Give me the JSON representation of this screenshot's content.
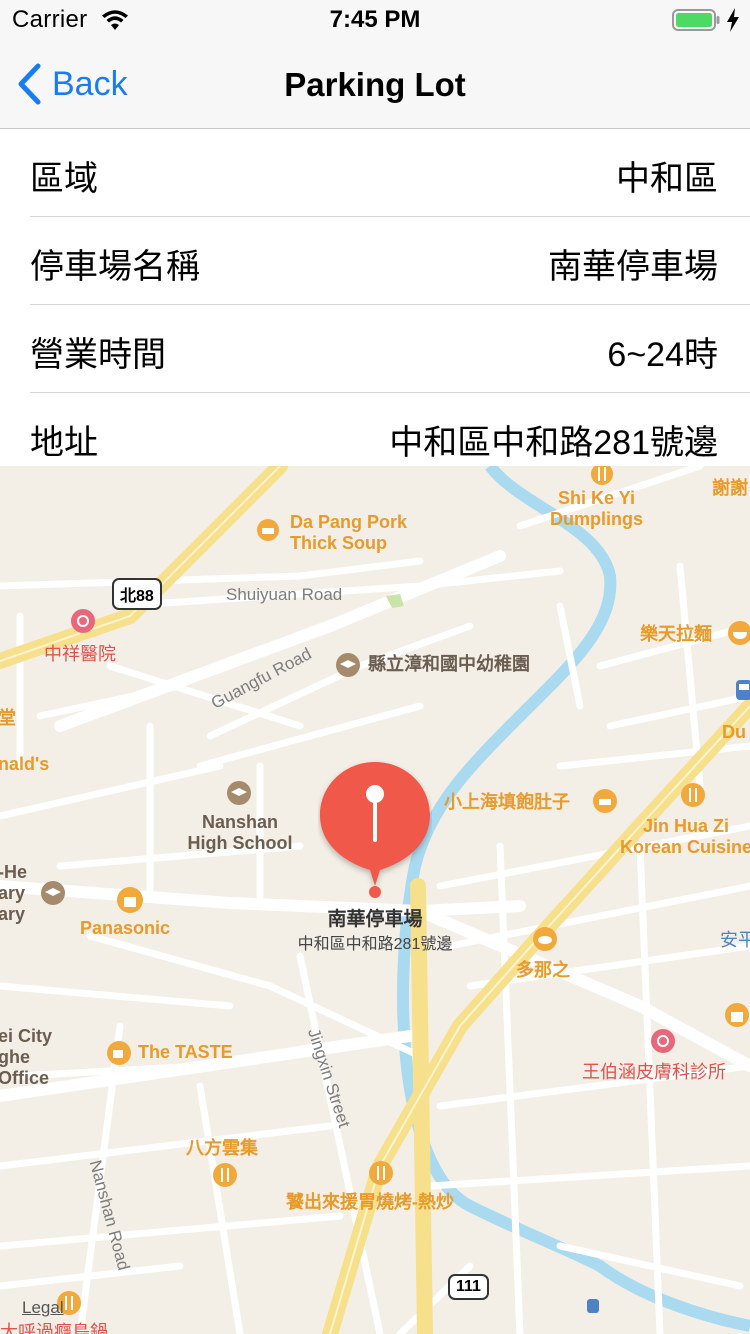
{
  "status_bar": {
    "carrier": "Carrier",
    "time": "7:45 PM"
  },
  "nav": {
    "back_label": "Back",
    "title": "Parking Lot"
  },
  "details": [
    {
      "label": "區域",
      "value": "中和區"
    },
    {
      "label": "停車場名稱",
      "value": "南華停車場"
    },
    {
      "label": "營業時間",
      "value": "6~24時"
    },
    {
      "label": "地址",
      "value": "中和區中和路281號邊"
    }
  ],
  "map": {
    "pin": {
      "name": "南華停車場",
      "address": "中和區中和路281號邊"
    },
    "roads": {
      "shuiyuan": "Shuiyuan Road",
      "guangfu": "Guangfu Road",
      "jingxin": "Jingxin Street",
      "nanshan": "Nanshan Road"
    },
    "shields": {
      "bei88": "北88",
      "r111": "111"
    },
    "pois": {
      "dapang_line1": "Da Pang Pork",
      "dapang_line2": "Thick Soup",
      "shikeyi_line1": "Shi Ke Yi",
      "shikeyi_line2": "Dumplings",
      "xie": "謝謝",
      "zhongxiang": "中祥醫院",
      "kindergarten": "縣立漳和國中幼稚園",
      "letian": "樂天拉麵",
      "du": "Du",
      "nalds": "nald's",
      "nanshan_line1": "Nanshan",
      "nanshan_line2": "High School",
      "xiaoshanghai": "小上海填飽肚子",
      "jinhua_line1": "Jin Hua Zi",
      "jinhua_line2": "Korean Cuisine",
      "he_line1": "-He",
      "he_line2": "ary",
      "he_line3": "ary",
      "panasonic": "Panasonic",
      "anping": "安平",
      "duona": "多那之",
      "city_line1": "ei City",
      "city_line2": "ghe",
      "city_line3": "Office",
      "taste": "The TASTE",
      "wangbo": "王伯涵皮膚科診所",
      "bafang": "八方雲集",
      "canchu": "饕出來援胃燒烤-熱炒",
      "bottom": "大呼過癮島鍋",
      "tang": "堂"
    },
    "legal": "Legal",
    "colors": {
      "water": "#aadaf0",
      "road": "#ffffff",
      "highway": "#f7e08b",
      "land": "#f3efe7",
      "pin": "#f0584a"
    }
  }
}
